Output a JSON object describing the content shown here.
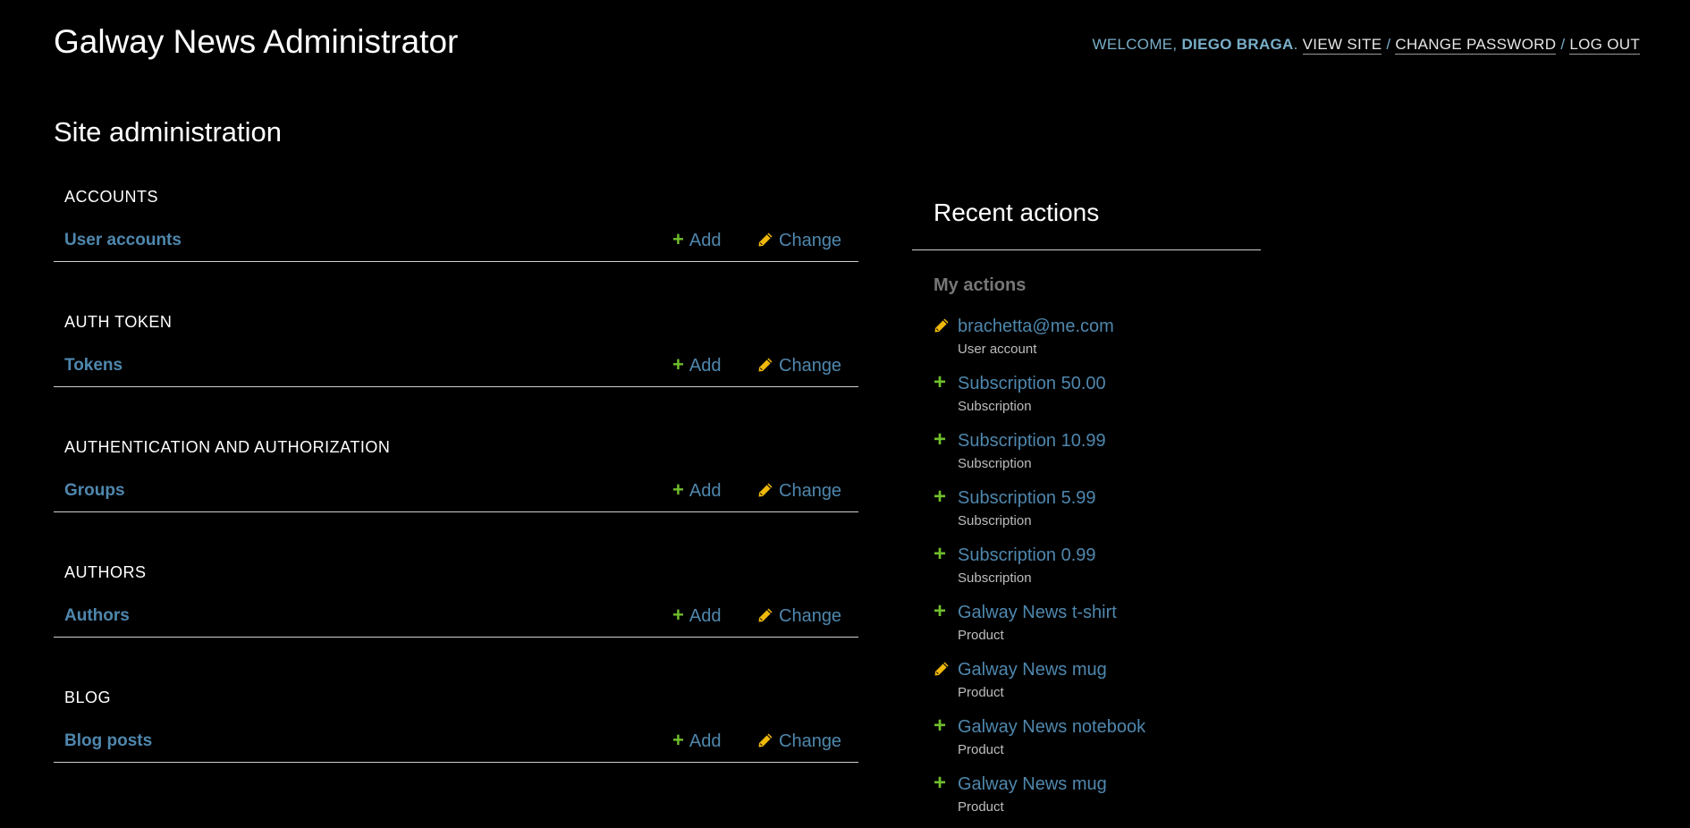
{
  "header": {
    "site_name": "Galway News Administrator",
    "welcome": "WELCOME,",
    "username": "DIEGO BRAGA",
    "view_site": "VIEW SITE",
    "change_password": "CHANGE PASSWORD",
    "log_out": "LOG OUT",
    "separator": "/"
  },
  "page_title": "Site administration",
  "modules": [
    {
      "caption": "ACCOUNTS",
      "model": "User accounts"
    },
    {
      "caption": "AUTH TOKEN",
      "model": "Tokens"
    },
    {
      "caption": "AUTHENTICATION AND AUTHORIZATION",
      "model": "Groups"
    },
    {
      "caption": "AUTHORS",
      "model": "Authors"
    },
    {
      "caption": "BLOG",
      "model": "Blog posts"
    }
  ],
  "links": {
    "add": "Add",
    "change": "Change"
  },
  "recent": {
    "title": "Recent actions",
    "subtitle": "My actions",
    "actions": [
      {
        "kind": "change",
        "title": "brachetta@me.com",
        "type": "User account"
      },
      {
        "kind": "add",
        "title": "Subscription 50.00",
        "type": "Subscription"
      },
      {
        "kind": "add",
        "title": "Subscription 10.99",
        "type": "Subscription"
      },
      {
        "kind": "add",
        "title": "Subscription 5.99",
        "type": "Subscription"
      },
      {
        "kind": "add",
        "title": "Subscription 0.99",
        "type": "Subscription"
      },
      {
        "kind": "add",
        "title": "Galway News t-shirt",
        "type": "Product"
      },
      {
        "kind": "change",
        "title": "Galway News mug",
        "type": "Product"
      },
      {
        "kind": "add",
        "title": "Galway News notebook",
        "type": "Product"
      },
      {
        "kind": "add",
        "title": "Galway News mug",
        "type": "Product"
      }
    ]
  },
  "colors": {
    "accent": "#4f87ad",
    "add_green": "#70bf2b",
    "change_yellow": "#efb80b"
  }
}
